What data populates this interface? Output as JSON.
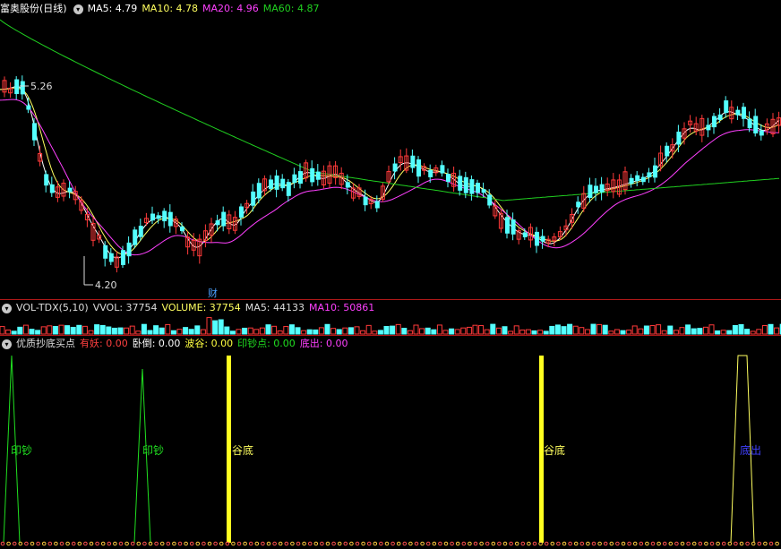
{
  "colors": {
    "up": "#ff3a3a",
    "down": "#54ffff",
    "ma5": "#ffffff",
    "ma10": "#ffff60",
    "ma20": "#ff40ff",
    "ma60": "#20d020",
    "axis": "#b01818"
  },
  "price": {
    "title": "富奥股份(日线)",
    "ma5_label": "MA5: 4.79",
    "ma10_label": "MA10: 4.78",
    "ma20_label": "MA20: 4.96",
    "ma60_label": "MA60: 4.87",
    "high_label": "5.26",
    "low_label": "4.20",
    "marker": "财"
  },
  "volume": {
    "name": "VOL-TDX(5,10)",
    "vvol": "VVOL: 37754",
    "volume": "VOLUME: 37754",
    "ma5": "MA5: 44133",
    "ma10": "MA10: 50861"
  },
  "indicator": {
    "name": "优质抄底买点",
    "items": [
      {
        "label": "有妖: 0.00",
        "color": "#ff4040"
      },
      {
        "label": "卧倒: 0.00",
        "color": "#ffffff"
      },
      {
        "label": "波谷: 0.00",
        "color": "#ffff40"
      },
      {
        "label": "印钞点: 0.00",
        "color": "#20e020"
      },
      {
        "label": "底出: 0.00",
        "color": "#ff40ff"
      }
    ],
    "signals": [
      {
        "text": "印钞",
        "color": "#20e020"
      },
      {
        "text": "印钞",
        "color": "#20e020"
      },
      {
        "text": "谷底",
        "color": "#ffff60"
      },
      {
        "text": "谷底",
        "color": "#ffff60"
      },
      {
        "text": "底出",
        "color": "#4040ff"
      }
    ]
  }
}
